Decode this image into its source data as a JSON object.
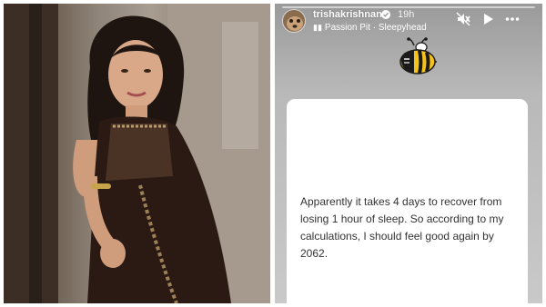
{
  "story": {
    "username": "trishakrishnan",
    "time_ago": "19h",
    "music": {
      "artist": "Passion Pit",
      "separator": "·",
      "track": "Sleepyhead"
    },
    "sticker_icon": "sleepy-bee-sticker",
    "post_text": "Apparently it takes 4 days to recover from losing 1 hour of sleep. So according to my calculations, I should feel good again by 2062.",
    "controls": [
      "mute-icon",
      "play-icon",
      "more-options-icon"
    ]
  },
  "colors": {
    "story_background": "#b5b5b5",
    "card": "#ffffff",
    "text": "#333333",
    "verified": "#3897f0",
    "bee_body": "#f5c21b"
  }
}
